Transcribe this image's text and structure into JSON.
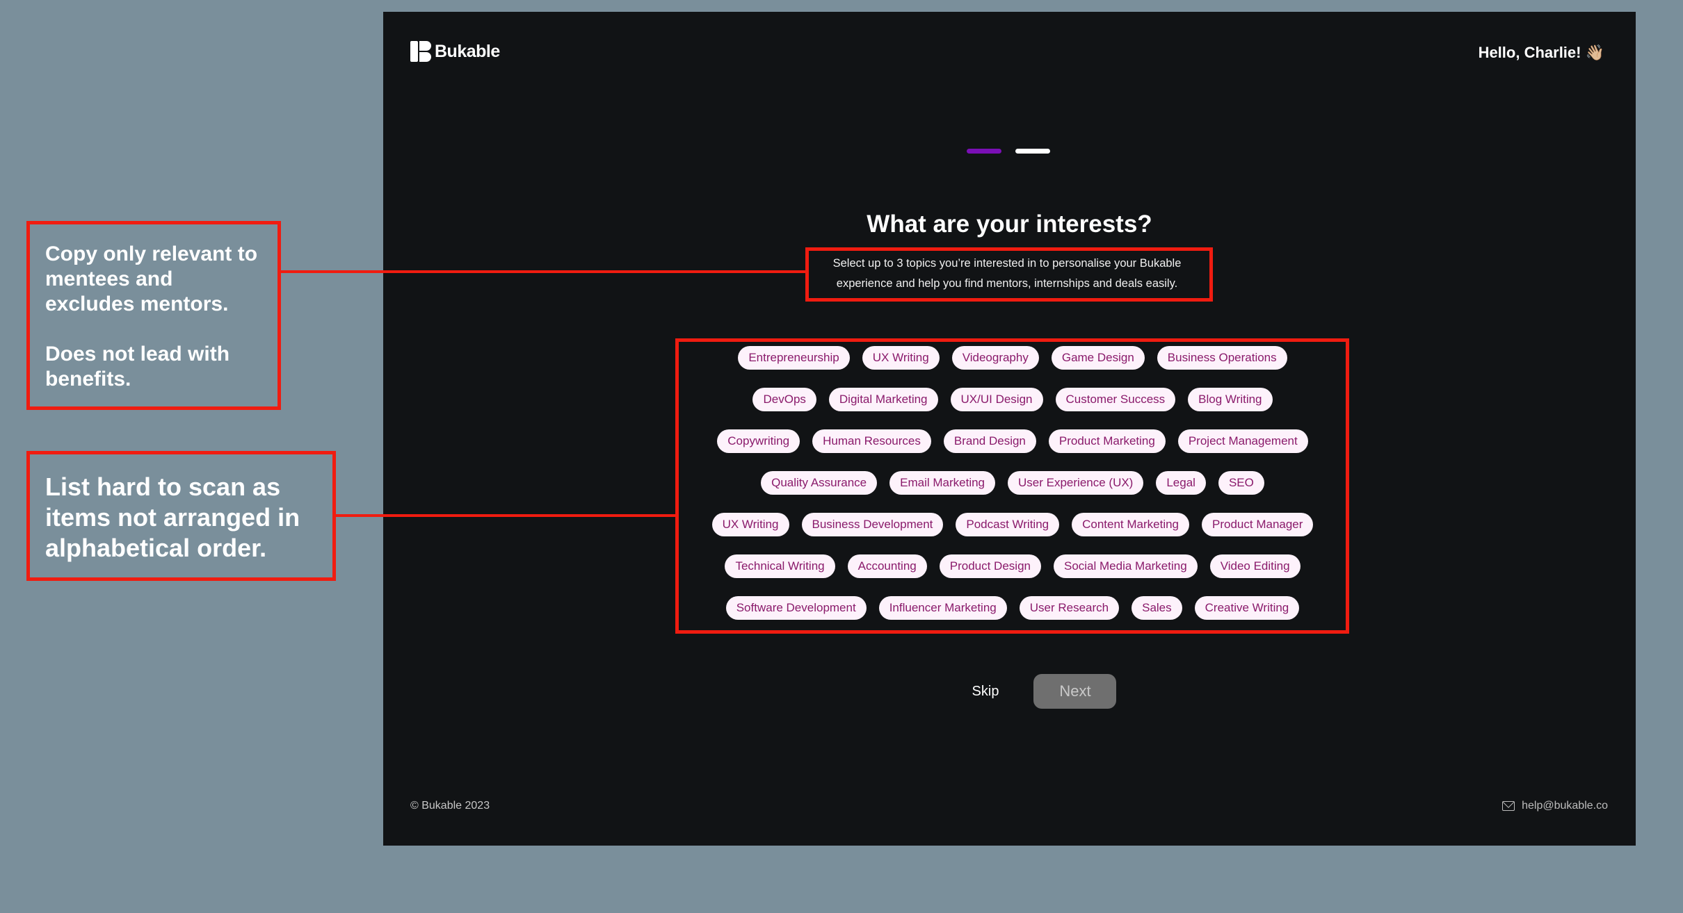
{
  "app": {
    "brand": "Bukable",
    "greeting": "Hello, Charlie! 👋🏼",
    "stepper": {
      "total_steps": 2,
      "current_step": 1,
      "colors": {
        "active": "#7a0fb5",
        "inactive": "#ffffff"
      }
    },
    "title": "What are your interests?",
    "subtitle": "Select up to 3 topics you’re interested in to personalise your Bukable experience and help you find mentors, internships and deals easily.",
    "chip_rows": [
      [
        "Entrepreneurship",
        "UX Writing",
        "Videography",
        "Game Design",
        "Business Operations"
      ],
      [
        "DevOps",
        "Digital Marketing",
        "UX/UI Design",
        "Customer Success",
        "Blog Writing"
      ],
      [
        "Copywriting",
        "Human Resources",
        "Brand Design",
        "Product Marketing",
        "Project Management"
      ],
      [
        "Quality Assurance",
        "Email Marketing",
        "User Experience (UX)",
        "Legal",
        "SEO"
      ],
      [
        "UX Writing",
        "Business Development",
        "Podcast Writing",
        "Content Marketing",
        "Product Manager"
      ],
      [
        "Technical Writing",
        "Accounting",
        "Product Design",
        "Social Media Marketing",
        "Video Editing"
      ],
      [
        "Software Development",
        "Influencer Marketing",
        "User Research",
        "Sales",
        "Creative Writing"
      ]
    ],
    "actions": {
      "skip": "Skip",
      "next": "Next"
    },
    "footer": {
      "copyright": "© Bukable 2023",
      "email": "help@bukable.co"
    }
  },
  "annotations": [
    {
      "text": "Copy only relevant to\nmentees and\nexcludes mentors.\n\nDoes not lead with\nbenefits."
    },
    {
      "text": "List hard to scan as\nitems not arranged in\nalphabetical order."
    }
  ],
  "colors": {
    "background": "#7a8f9b",
    "app_bg": "#111315",
    "chip_bg": "#fdf2fb",
    "chip_text": "#8a1a6b",
    "annotation_red": "#f01c10",
    "next_button_bg": "#6f6f6f"
  }
}
